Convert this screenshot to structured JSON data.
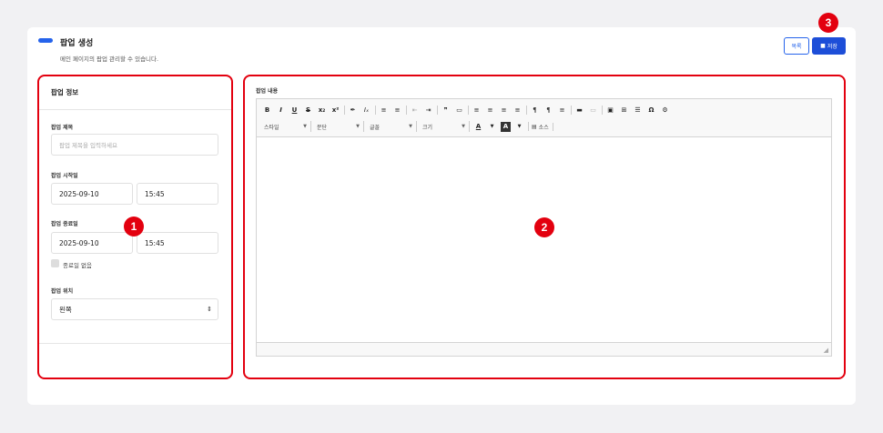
{
  "header": {
    "title": "팝업 생성",
    "description": "메인 페이지의 팝업 관리할 수 있습니다.",
    "list_button": "목록",
    "save_button": "저장",
    "save_icon": "floppy-disk-icon"
  },
  "form": {
    "panel_title": "팝업 정보",
    "title_label": "팝업 제목",
    "title_placeholder": "팝업 제목을 입력하세요",
    "start_label": "팝업 시작일",
    "start_date": "2025-09-10",
    "start_time": "15:45",
    "end_label": "팝업 종료일",
    "end_date": "2025-09-10",
    "end_time": "15:45",
    "no_end_label": "종료일 없음",
    "position_label": "팝업 위치",
    "position_value": "왼쪽"
  },
  "editor": {
    "label": "팝업 내용",
    "combos": {
      "style": "스타일",
      "format": "문단",
      "font": "글꼴",
      "size": "크기"
    },
    "source_label": "소스",
    "toolbar_row1": [
      "B",
      "I",
      "U",
      "S",
      "x₂",
      "x²",
      "✎",
      "Ix",
      "≡",
      "≡",
      "⇤",
      "⇥",
      "❞",
      "▭",
      "≡",
      "≡",
      "≡",
      "≡",
      "¶",
      "¶",
      "≡",
      "▬",
      "▭",
      "▣",
      "⊞",
      "☰",
      "Ω",
      "⚙"
    ]
  },
  "annotations": {
    "badge1": "1",
    "badge2": "2",
    "badge3": "3",
    "color": "#e3000f"
  },
  "colors": {
    "primary": "#2563eb",
    "save_bg": "#1d4ed8",
    "annotation": "#e3000f"
  }
}
